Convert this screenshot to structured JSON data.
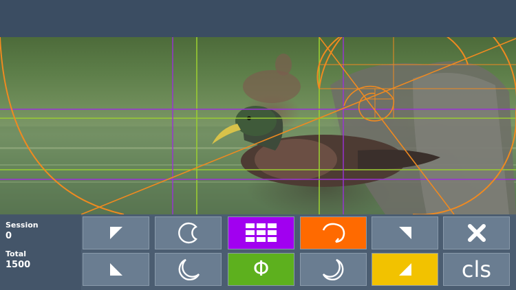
{
  "colors": {
    "accent_purple": "#a100f0",
    "accent_orange": "#ff6a00",
    "accent_green": "#5db01e",
    "accent_yellow": "#f2c200",
    "button_default": "#6a7d91",
    "grid_green": "#9acd32",
    "grid_purple": "#9b30d9",
    "grid_orange": "#f08a20"
  },
  "stats": {
    "session_label": "Session",
    "session_value": "0",
    "total_label": "Total",
    "total_value": "1500"
  },
  "buttons": {
    "phi_label": "Φ",
    "cls_label": "cls"
  },
  "icons": {
    "row1": [
      "corner-top-left-icon",
      "crescent-left-icon",
      "grid-icon",
      "spiral-icon",
      "corner-top-right-icon",
      "close-icon"
    ],
    "row2": [
      "corner-bottom-left-icon",
      "moon-icon",
      "phi-icon",
      "crescent-right-icon",
      "corner-bottom-right-icon",
      "clear-screen-icon"
    ]
  }
}
